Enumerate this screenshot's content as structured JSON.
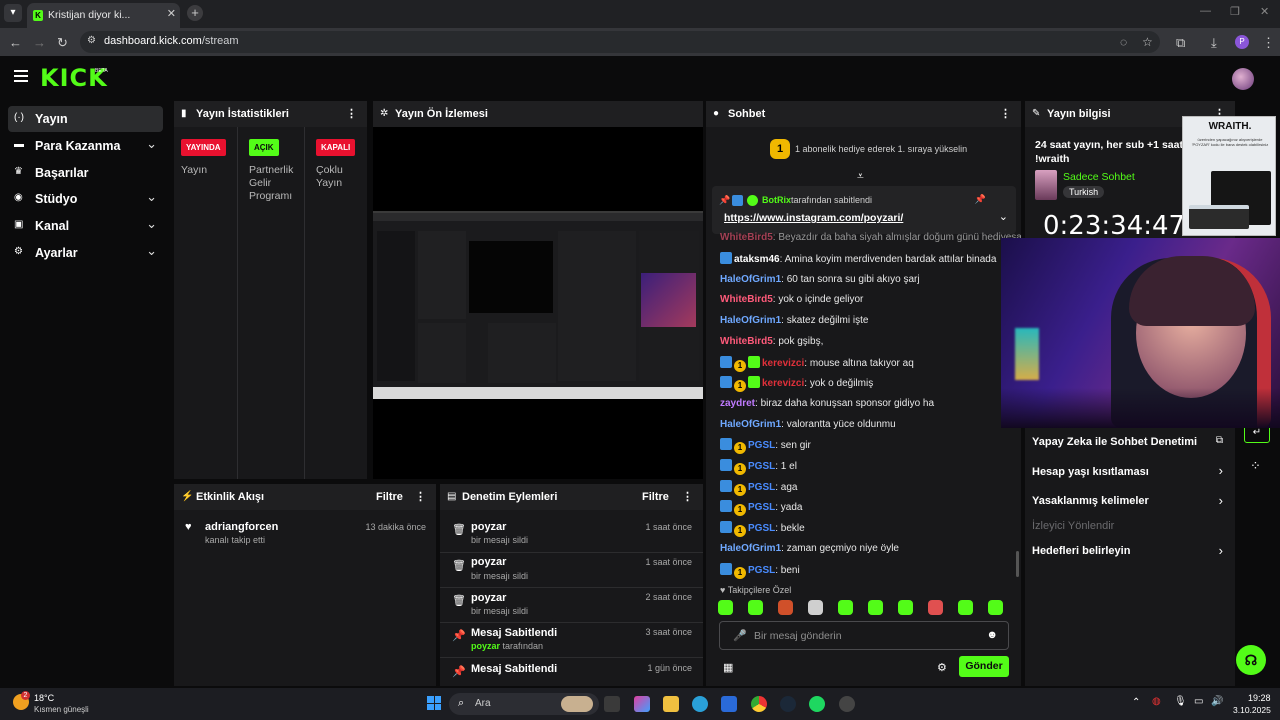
{
  "browser": {
    "tab_title": "Kristijan diyor ki...",
    "url_host": "dashboard.kick.com",
    "url_path": "/stream",
    "profile_letter": "P"
  },
  "header": {
    "logo": "KICK",
    "beta": "BETA"
  },
  "sidebar": {
    "items": [
      {
        "label": "Yayın",
        "icon": "broadcast-icon"
      },
      {
        "label": "Para Kazanma",
        "icon": "money-icon"
      },
      {
        "label": "Başarılar",
        "icon": "trophy-icon"
      },
      {
        "label": "Stüdyo",
        "icon": "studio-icon"
      },
      {
        "label": "Kanal",
        "icon": "channel-icon"
      },
      {
        "label": "Ayarlar",
        "icon": "gear-icon"
      }
    ]
  },
  "stats": {
    "title": "Yayın İstatistikleri",
    "cols": [
      {
        "badge": "YAYINDA",
        "label": "Yayın",
        "color": "#e9112f"
      },
      {
        "badge": "AÇIK",
        "label": "Partnerlik Gelir Programı",
        "color": "#53fc18"
      },
      {
        "badge": "KAPALI",
        "label": "Çoklu Yayın",
        "color": "#e9112f"
      }
    ]
  },
  "preview": {
    "title": "Yayın Ön İzlemesi"
  },
  "activity": {
    "title": "Etkinlik Akışı",
    "filter": "Filtre",
    "items": [
      {
        "name": "adriangforcen",
        "sub": "kanalı takip etti",
        "time": "13 dakika önce"
      }
    ]
  },
  "moderation": {
    "title": "Denetim Eylemleri",
    "filter": "Filtre",
    "items": [
      {
        "name": "poyzar",
        "sub": "bir mesajı sildi",
        "time": "1 saat önce",
        "icon": "trash-icon"
      },
      {
        "name": "poyzar",
        "sub": "bir mesajı sildi",
        "time": "1 saat önce",
        "icon": "trash-icon"
      },
      {
        "name": "poyzar",
        "sub": "bir mesajı sildi",
        "time": "2 saat önce",
        "icon": "trash-icon"
      },
      {
        "name": "Mesaj Sabitlendi",
        "sub_user": "poyzar",
        "sub": "tarafından",
        "time": "3 saat önce",
        "icon": "pin-icon"
      },
      {
        "name": "Mesaj Sabitlendi",
        "sub": "",
        "time": "1 gün önce",
        "icon": "pin-icon"
      }
    ]
  },
  "chat": {
    "title": "Sohbet",
    "gift_rank": "1",
    "gift_text": "1 abonelik hediye ederek 1. sıraya yükselin",
    "pinned_by": "BotRix",
    "pinned_suffix": "tarafından sabitlendi",
    "pinned_link": "https://www.instagram.com/poyzari/",
    "cutoff_user": "WhiteBird5",
    "cutoff_text": "Beyazdır da baha siyah almışlar doğum günü hediyesa",
    "messages": [
      {
        "user": "ataksm46",
        "text": "Amina koyim merdivenden bardak attılar binada",
        "color": "#ffffff",
        "badges": [
          "kick"
        ]
      },
      {
        "user": "HaleOfGrim1",
        "text": "60 tan sonra su gibi akıyo şarj",
        "color": "#6fa8ff",
        "badges": []
      },
      {
        "user": "WhiteBird5",
        "text": "yok o içinde geliyor",
        "color": "#ff5a7a",
        "badges": []
      },
      {
        "user": "HaleOfGrim1",
        "text": "skatez değilmi işte",
        "color": "#6fa8ff",
        "badges": []
      },
      {
        "user": "WhiteBird5",
        "text": "pok gşibş,",
        "color": "#ff5a7a",
        "badges": []
      },
      {
        "user": "kerevizci",
        "text": "mouse altına takıyor aq",
        "color": "#e0303a",
        "badges": [
          "kick",
          "sub",
          "green"
        ]
      },
      {
        "user": "kerevizci",
        "text": "yok o değilmiş",
        "color": "#e0303a",
        "badges": [
          "kick",
          "sub",
          "green"
        ]
      },
      {
        "user": "zaydret",
        "text": "biraz daha konuşsan sponsor gidiyo ha",
        "color": "#c07bff",
        "badges": []
      },
      {
        "user": "HaleOfGrim1",
        "text": "valorantta yüce oldunmu",
        "color": "#6fa8ff",
        "badges": []
      },
      {
        "user": "PGSL",
        "text": "sen gir",
        "color": "#4a8cff",
        "badges": [
          "kick",
          "sub"
        ]
      },
      {
        "user": "PGSL",
        "text": "1 el",
        "color": "#4a8cff",
        "badges": [
          "kick",
          "sub"
        ]
      },
      {
        "user": "PGSL",
        "text": "aga",
        "color": "#4a8cff",
        "badges": [
          "kick",
          "sub"
        ]
      },
      {
        "user": "PGSL",
        "text": "yada",
        "color": "#4a8cff",
        "badges": [
          "kick",
          "sub"
        ]
      },
      {
        "user": "PGSL",
        "text": "bekle",
        "color": "#4a8cff",
        "badges": [
          "kick",
          "sub"
        ]
      },
      {
        "user": "HaleOfGrim1",
        "text": "zaman geçmiyo niye öyle",
        "color": "#6fa8ff",
        "badges": []
      },
      {
        "user": "PGSL",
        "text": "beni",
        "color": "#4a8cff",
        "badges": [
          "kick",
          "sub"
        ]
      }
    ],
    "followers_label": "Takipçilere Özel",
    "input_placeholder": "Bir mesaj gönderin",
    "send_label": "Gönder"
  },
  "info": {
    "title": "Yayın bilgisi",
    "stream_title": "24 saat yayın, her sub +1 saat | !i",
    "stream_cmd": "!wraith",
    "category": "Sadece Sohbet",
    "language": "Turkish",
    "timer": "0:23:34:47",
    "overlay_brand": "WRAITH.",
    "overlay_text": "üzerinden yapacağınız alışverişlerde 'POYZAR' kodu ile bana destek olabilirsiniz",
    "rows": [
      {
        "label": "Yapay Zeka ile Sohbet Denetimi",
        "icon": "external-link-icon"
      },
      {
        "label": "Hesap yaşı kısıtlaması",
        "icon": "chevron-right-icon"
      },
      {
        "label": "Yasaklanmış kelimeler",
        "icon": "chevron-right-icon"
      },
      {
        "label": "İzleyici Yönlendir",
        "icon": ""
      },
      {
        "label": "Hedefleri belirleyin",
        "icon": "chevron-right-icon"
      }
    ]
  },
  "taskbar": {
    "temp": "18°C",
    "weather": "Kısmen güneşli",
    "search": "Ara",
    "time": "19:28",
    "date": "3.10.2025",
    "weather_badge": "2"
  }
}
